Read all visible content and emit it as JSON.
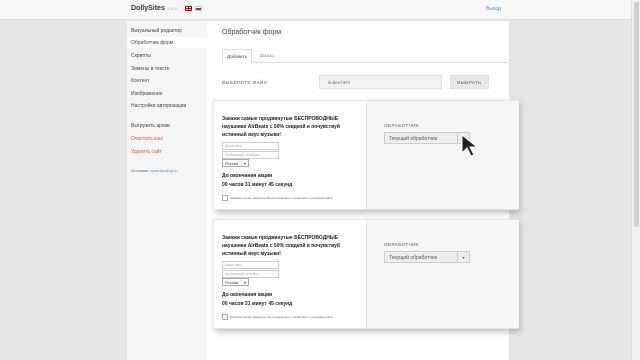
{
  "header": {
    "brand": "DollySites",
    "version": "1.6.8",
    "logout": "Выход"
  },
  "sidebar": {
    "items": [
      {
        "label": "Визуальный редактор"
      },
      {
        "label": "Обработчик форм"
      },
      {
        "label": "Скрипты"
      },
      {
        "label": "Замены в тексте"
      },
      {
        "label": "Контент"
      },
      {
        "label": "Изображения"
      },
      {
        "label": "Настройки авторизации"
      }
    ],
    "actions": [
      {
        "label": "Выгрузить архив"
      },
      {
        "label": "Очистить кэш"
      },
      {
        "label": "Удалить сайт"
      }
    ],
    "source_label": "Источник:",
    "source_link": "www.landing.ru"
  },
  "main": {
    "title": "Обработчик форм",
    "tabs": [
      {
        "label": "Добавить"
      },
      {
        "label": "Заказы"
      }
    ],
    "file_label": "ВЫБЕРИТЕ ФАЙЛ",
    "file_value": "/index.html",
    "select_button": "ВЫБРАТЬ",
    "blocks": [
      {
        "promo": "Закажи самые продвинутые БЕСПРОВОДНЫЕ наушники AirBeats с 50% скидкой и почувствуй истинный вкус музыки!",
        "name_placeholder": "Ваше имя",
        "phone_placeholder": "Мобильный телефон",
        "country": "Россия",
        "deadline_title": "До окончания акции",
        "deadline_time": "00 часов 31 минут 45 секунд",
        "agree_text": "Нажимая кнопку «Заказать» Вы соглашаетесь с правилами и условиями сайта",
        "handler_label": "ОБРАБОТЧИК",
        "handler_value": "Текущий обработчик"
      },
      {
        "promo": "Закажи самые продвинутые БЕСПРОВОДНЫЕ наушники AirBeats с 50% скидкой и почувствуй истинный вкус музыки!",
        "name_placeholder": "Ваше имя",
        "phone_placeholder": "Мобильный телефон",
        "country": "Россия",
        "deadline_title": "До окончания акции",
        "deadline_time": "00 часов 31 минут 45 секунд",
        "agree_text": "Нажимая кнопку «Заказать» Вы соглашаетесь с правилами и условиями сайта",
        "handler_label": "ОБРАБОТЧИК",
        "handler_value": "Текущий обработчик"
      }
    ]
  },
  "colors": {
    "background": "#e6e6e6",
    "link": "#4a90c8",
    "danger": "#d9534f"
  }
}
